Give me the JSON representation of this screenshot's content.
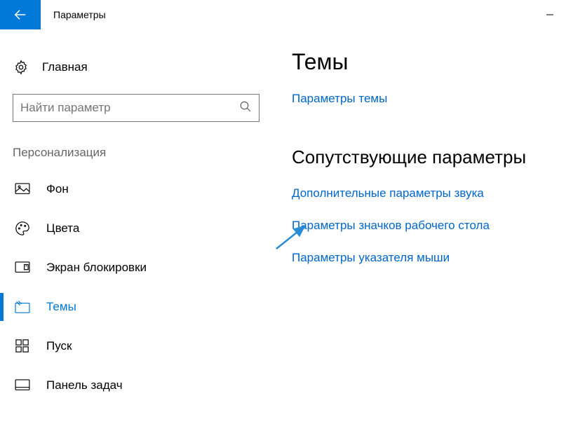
{
  "window": {
    "title": "Параметры"
  },
  "sidebar": {
    "home_label": "Главная",
    "search_placeholder": "Найти параметр",
    "section_label": "Персонализация",
    "items": [
      {
        "label": "Фон"
      },
      {
        "label": "Цвета"
      },
      {
        "label": "Экран блокировки"
      },
      {
        "label": "Темы"
      },
      {
        "label": "Пуск"
      },
      {
        "label": "Панель задач"
      }
    ]
  },
  "main": {
    "heading": "Темы",
    "theme_settings_link": "Параметры темы",
    "related_heading": "Сопутствующие параметры",
    "related_links": [
      "Дополнительные параметры звука",
      "Параметры значков рабочего стола",
      "Параметры указателя мыши"
    ]
  }
}
